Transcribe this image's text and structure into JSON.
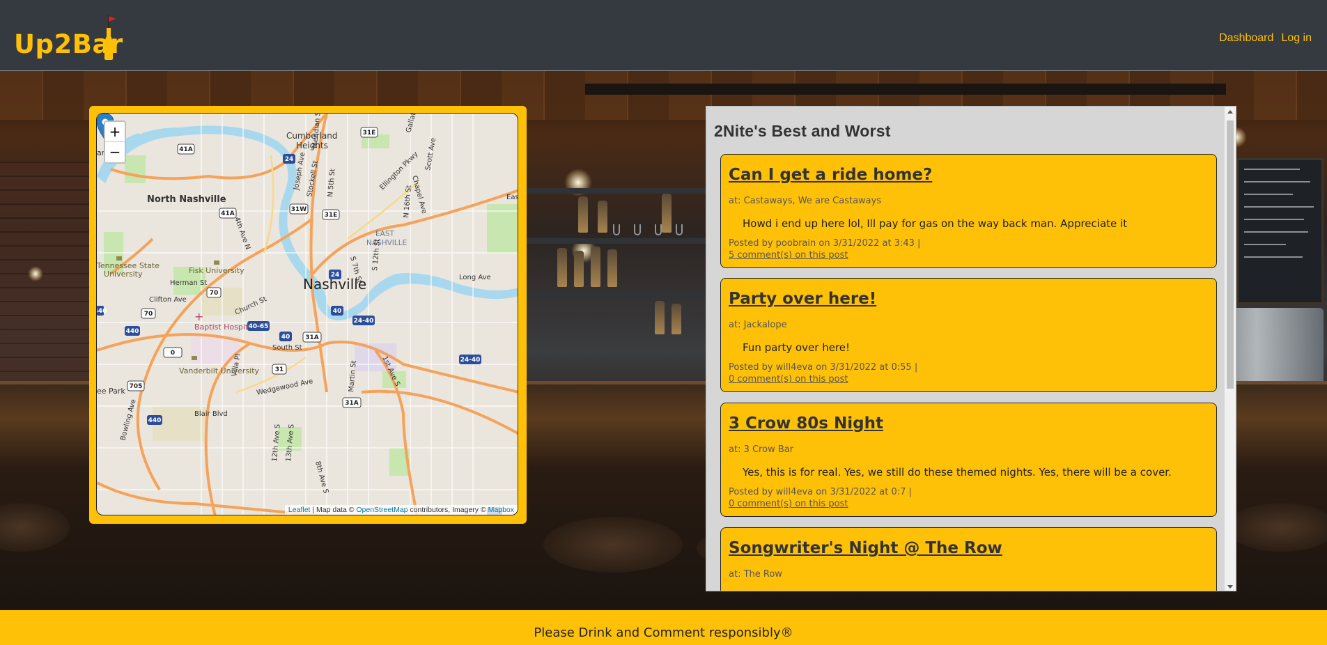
{
  "brand": {
    "name": "Up2Bar",
    "icon": "beer-bottle-flag-icon",
    "accent": "#ffc107"
  },
  "nav": {
    "items": [
      {
        "label": "Dashboard"
      },
      {
        "label": "Log in"
      }
    ]
  },
  "map": {
    "zoom_in": "+",
    "zoom_out": "−",
    "labels": {
      "cumberland": "Cumberland",
      "heights": "Heights",
      "north_nashville": "North Nashville",
      "east": "EAST",
      "east_nashville": "NASHVILLE",
      "nashville": "Nashville",
      "tsu1": "Tennessee State",
      "tsu2": "University",
      "fisk": "Fisk University",
      "herman": "Herman St",
      "clifton": "Clifton Ave",
      "church": "Church St",
      "baptist": "Baptist Hospital",
      "south": "South St",
      "vanderbilt": "Vanderbilt University",
      "wedgewood": "Wedgewood Ave",
      "blair": "Blair Blvd",
      "bowling": "Bowling Ave",
      "lee_park": "ee Park",
      "long_ave": "Long Ave",
      "ellington": "Ellington Pkwy",
      "martin": "Martin St",
      "first_ave": "1st Ave S",
      "twelfth": "12th Ave S",
      "eighth": "8th Ave S",
      "fourth_ave": "4th Ave N",
      "joseph": "Joseph Ave",
      "stockell": "Stockell St",
      "n5th": "N 5th St",
      "meridian": "Meridian St",
      "gallatin": "Gallatin",
      "chapel": "Chapel Ave",
      "scott": "Scott Ave",
      "n16th": "N 16th St",
      "s7th": "S 7th St",
      "s12th": "S 12th St",
      "villa": "Villa Pl",
      "thirteenth": "13th Ave S",
      "ard": "ard",
      "east_edge": "Eas"
    },
    "shields": [
      "41A",
      "41A",
      "31E",
      "31E",
      "24",
      "24",
      "31W",
      "70",
      "70",
      "40-65",
      "40",
      "40",
      "24-40",
      "24-40",
      "31A",
      "31A",
      "31",
      "440",
      "440",
      "705",
      "31A",
      "0",
      "440"
    ],
    "attribution": {
      "leaflet": "Leaflet",
      "mid": " | Map data © ",
      "osm": "OpenStreetMap",
      "contrib": " contributors, Imagery © ",
      "mapbox": "Mapbox"
    }
  },
  "feed": {
    "title": "2Nite's Best and Worst",
    "posts": [
      {
        "title": "Can I get a ride home?",
        "at": "at: Castaways, We are Castaways",
        "body": "Howd i end up here lol, Ill pay for gas on the way back man. Appreciate it",
        "meta": "Posted by poobrain on 3/31/2022 at 3:43 |",
        "comments": "5 comment(s) on this post"
      },
      {
        "title": "Party over here!",
        "at": "at: Jackalope",
        "body": "Fun party over here!",
        "meta": "Posted by will4eva on 3/31/2022 at 0:55 |",
        "comments": "0 comment(s) on this post"
      },
      {
        "title": "3 Crow 80s Night",
        "at": "at: 3 Crow Bar",
        "body": "Yes, this is for real. Yes, we still do these themed nights. Yes, there will be a cover.",
        "meta": "Posted by will4eva on 3/31/2022 at 0:7 |",
        "comments": "0 comment(s) on this post"
      },
      {
        "title": "Songwriter's Night @ The Row",
        "at": "at: The Row"
      }
    ]
  },
  "footer": {
    "text": "Please Drink and Comment responsibly®"
  }
}
